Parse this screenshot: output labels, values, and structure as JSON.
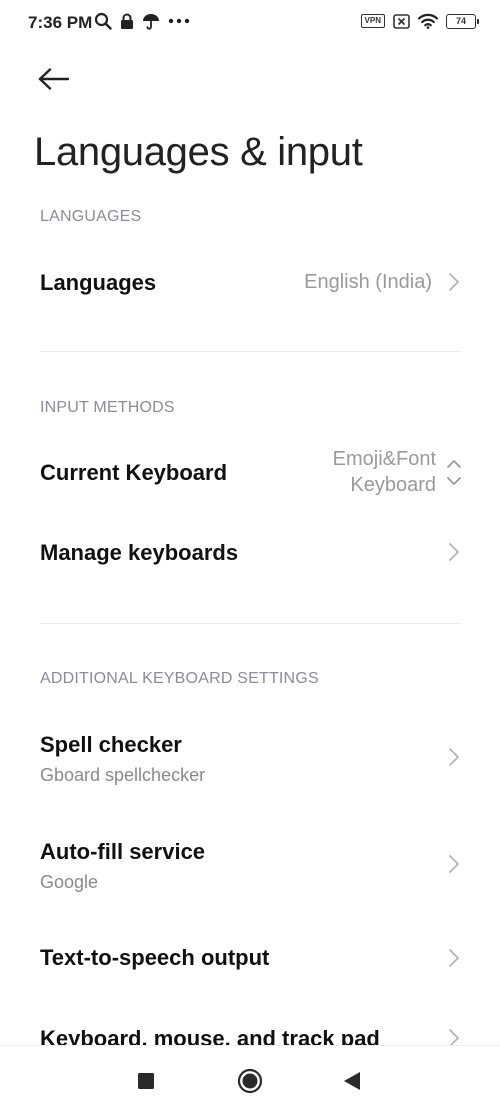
{
  "status_bar": {
    "time": "7:36 PM",
    "left_icons": [
      "search-icon",
      "lock-icon",
      "umbrella-icon",
      "more-dots-icon"
    ],
    "vpn_label": "VPN",
    "battery_level": "74"
  },
  "header": {
    "title": "Languages & input"
  },
  "sections": {
    "languages": {
      "header": "LANGUAGES",
      "languages_item": {
        "title": "Languages",
        "value": "English (India)"
      }
    },
    "input_methods": {
      "header": "INPUT METHODS",
      "current_keyboard": {
        "title": "Current Keyboard",
        "value_line1": "Emoji&Font",
        "value_line2": "Keyboard"
      },
      "manage_keyboards": {
        "title": "Manage keyboards"
      }
    },
    "additional": {
      "header": "ADDITIONAL KEYBOARD SETTINGS",
      "spell_checker": {
        "title": "Spell checker",
        "subtitle": "Gboard spellchecker"
      },
      "autofill": {
        "title": "Auto-fill service",
        "subtitle": "Google"
      },
      "tts": {
        "title": "Text-to-speech output"
      },
      "keyboard_mouse": {
        "title": "Keyboard, mouse, and track pad"
      }
    }
  },
  "colors": {
    "section_header": "#8a8d99",
    "value_text": "#9a9a9a",
    "background": "#ffffff"
  }
}
